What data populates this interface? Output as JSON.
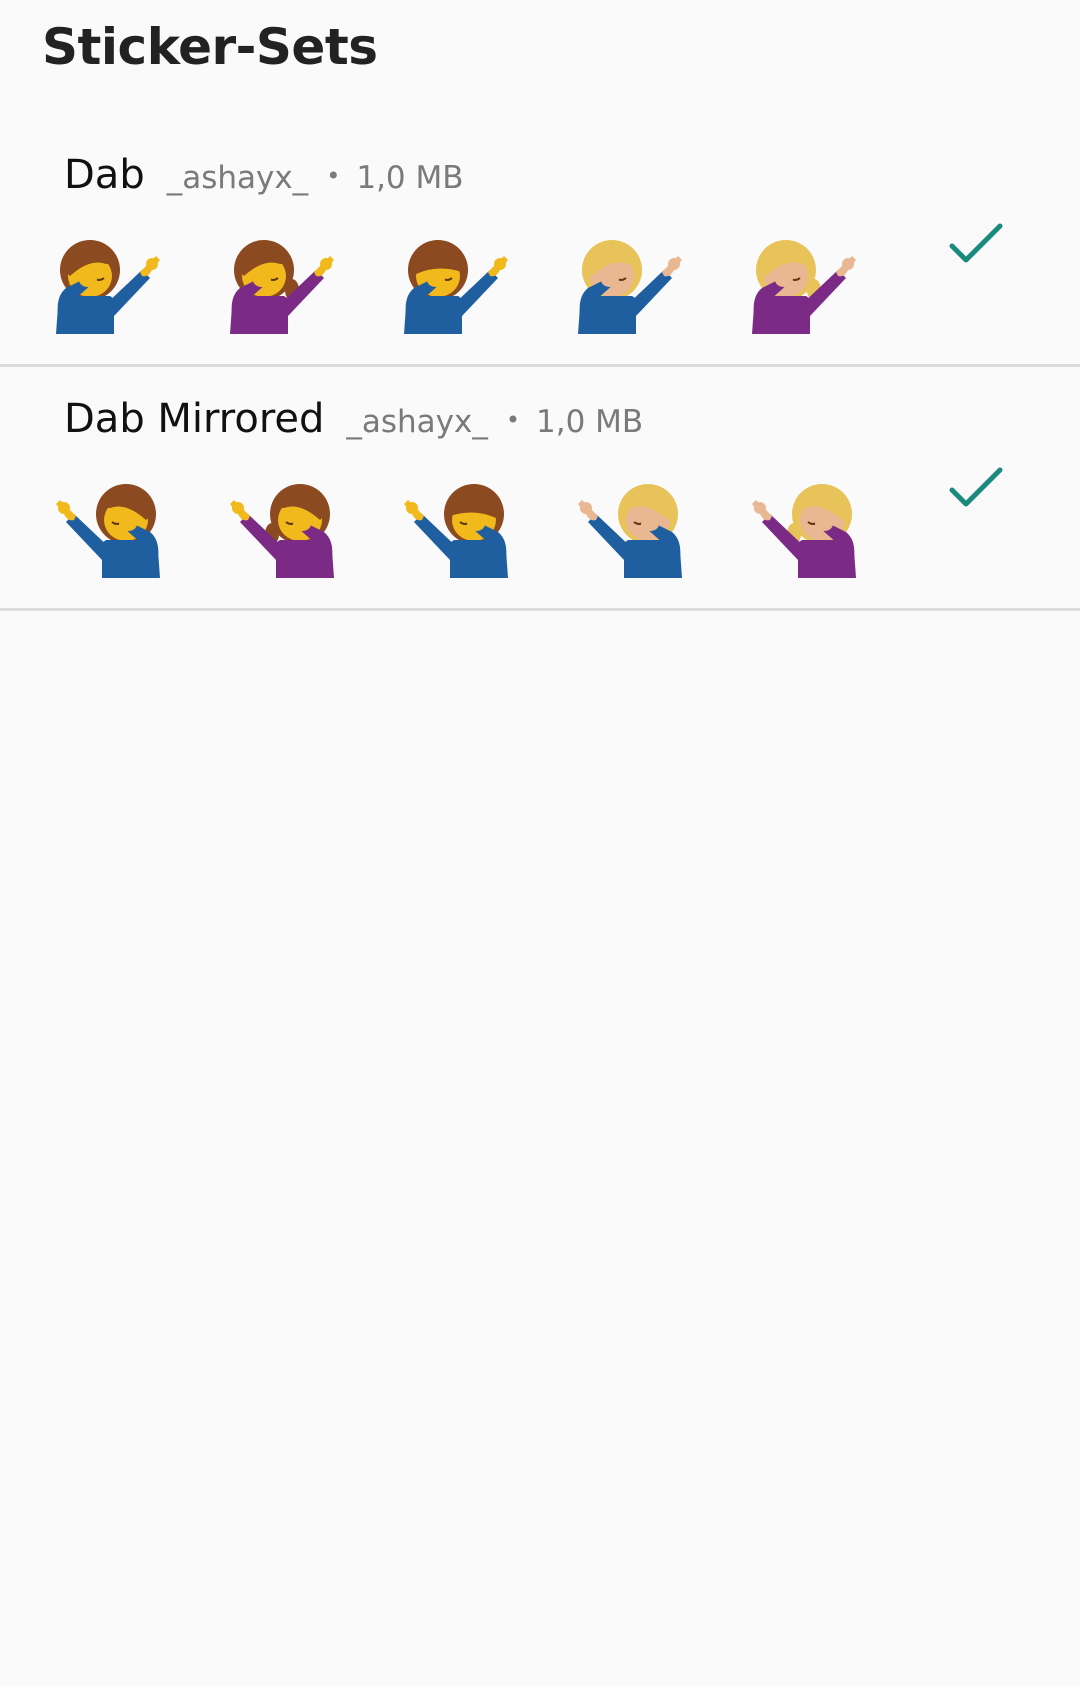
{
  "page": {
    "title": "Sticker-Sets"
  },
  "colors": {
    "accent_check": "#1a8a7e",
    "divider": "#dcdcdc",
    "background": "#fafafa",
    "skin": "#f2b91c",
    "skin_light": "#e9b892",
    "hair_brown": "#8b4a1f",
    "hair_blonde": "#e7c35a",
    "shirt_blue": "#1f5fa0",
    "shirt_purple": "#7b2a86"
  },
  "sticker_packs": [
    {
      "name": "Dab",
      "author": "_ashayx_",
      "separator": "•",
      "size": "1,0 MB",
      "installed_icon": "check-icon",
      "stickers": [
        {
          "icon": "dab-boy-brown-sticker"
        },
        {
          "icon": "dab-girl-brown-sticker"
        },
        {
          "icon": "dab-boy-brown-bangs-sticker"
        },
        {
          "icon": "dab-boy-blonde-sticker"
        },
        {
          "icon": "dab-girl-blonde-sticker"
        }
      ]
    },
    {
      "name": "Dab Mirrored",
      "author": "_ashayx_",
      "separator": "•",
      "size": "1,0 MB",
      "installed_icon": "check-icon",
      "stickers": [
        {
          "icon": "dab-boy-brown-mirrored-sticker"
        },
        {
          "icon": "dab-girl-brown-mirrored-sticker"
        },
        {
          "icon": "dab-boy-brown-bangs-mirrored-sticker"
        },
        {
          "icon": "dab-boy-blonde-mirrored-sticker"
        },
        {
          "icon": "dab-girl-blonde-mirrored-sticker"
        }
      ]
    }
  ]
}
